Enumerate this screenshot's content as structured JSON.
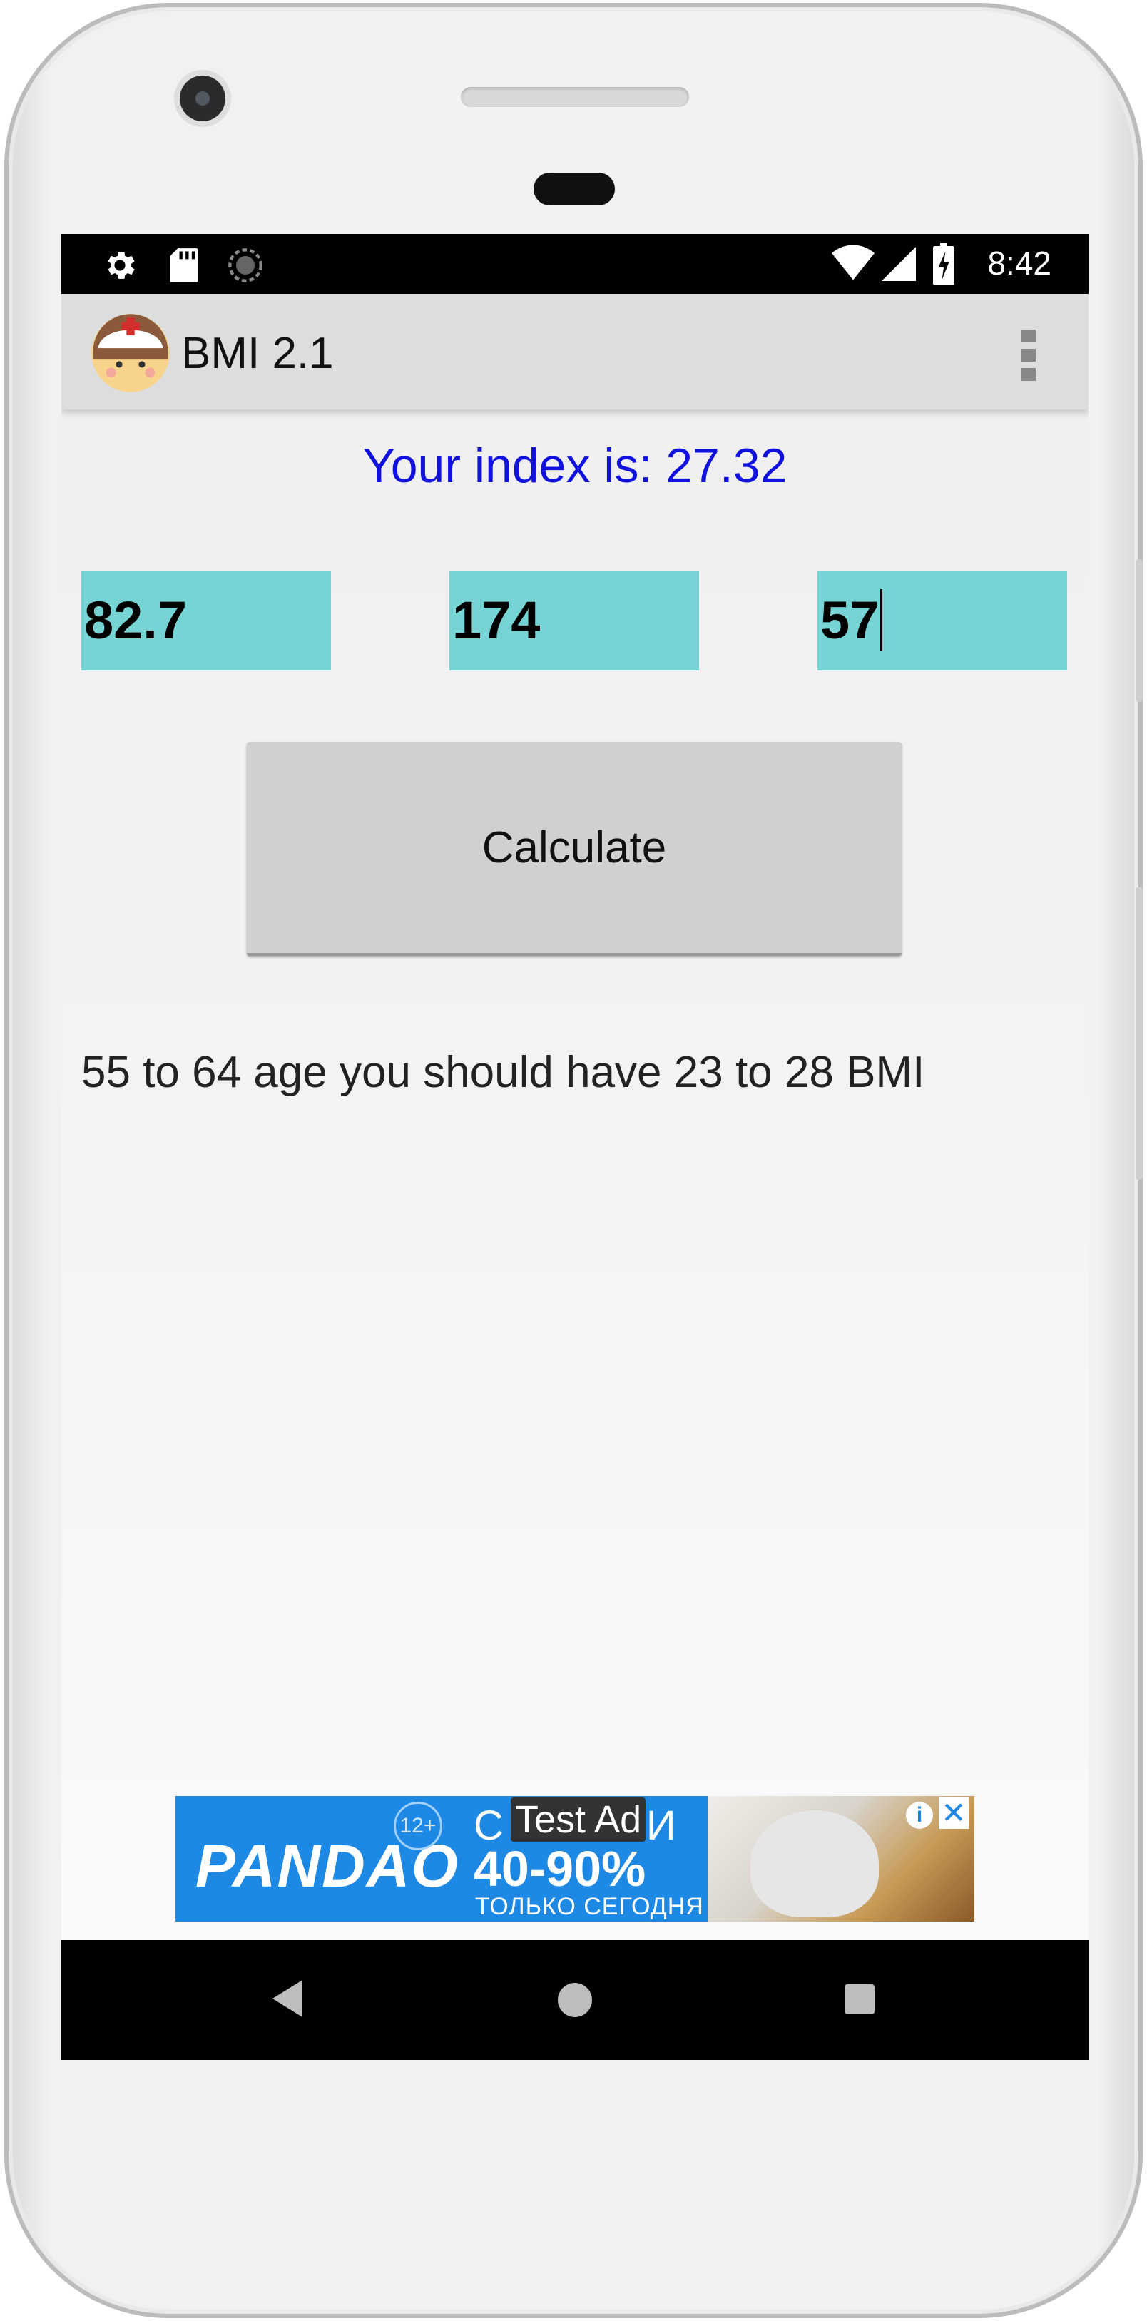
{
  "status_bar": {
    "time": "8:42",
    "left_icons": [
      "gear-icon",
      "sd-card-icon",
      "sync-icon"
    ],
    "right_icons": [
      "wifi-icon",
      "cell-signal-icon",
      "battery-charging-icon"
    ]
  },
  "app_bar": {
    "title": "BMI 2.1",
    "logo_icon": "nurse-avatar-icon",
    "menu_icon": "more-vertical-icon"
  },
  "result": {
    "text": "Your index is: 27.32",
    "color": "#1111dd"
  },
  "inputs": {
    "weight": "82.7",
    "height": "174",
    "age": "57",
    "background_color": "#76d4d4"
  },
  "calculate_button": {
    "label": "Calculate"
  },
  "advice": {
    "text": "55 to 64 age you should have 23 to 28 BMI"
  },
  "ad": {
    "brand": "PANDAO",
    "age_rating": "12+",
    "headline_top": "С",
    "headline_top_end": "И",
    "test_label": "Test Ad",
    "discount": "40-90%",
    "subtitle": "ТОЛЬКО СЕГОДНЯ",
    "info_icon": "info-icon",
    "close_icon": "close-icon",
    "background_color": "#1e88e5"
  },
  "nav_bar": {
    "icons": [
      "back-icon",
      "home-icon",
      "recents-icon"
    ]
  }
}
